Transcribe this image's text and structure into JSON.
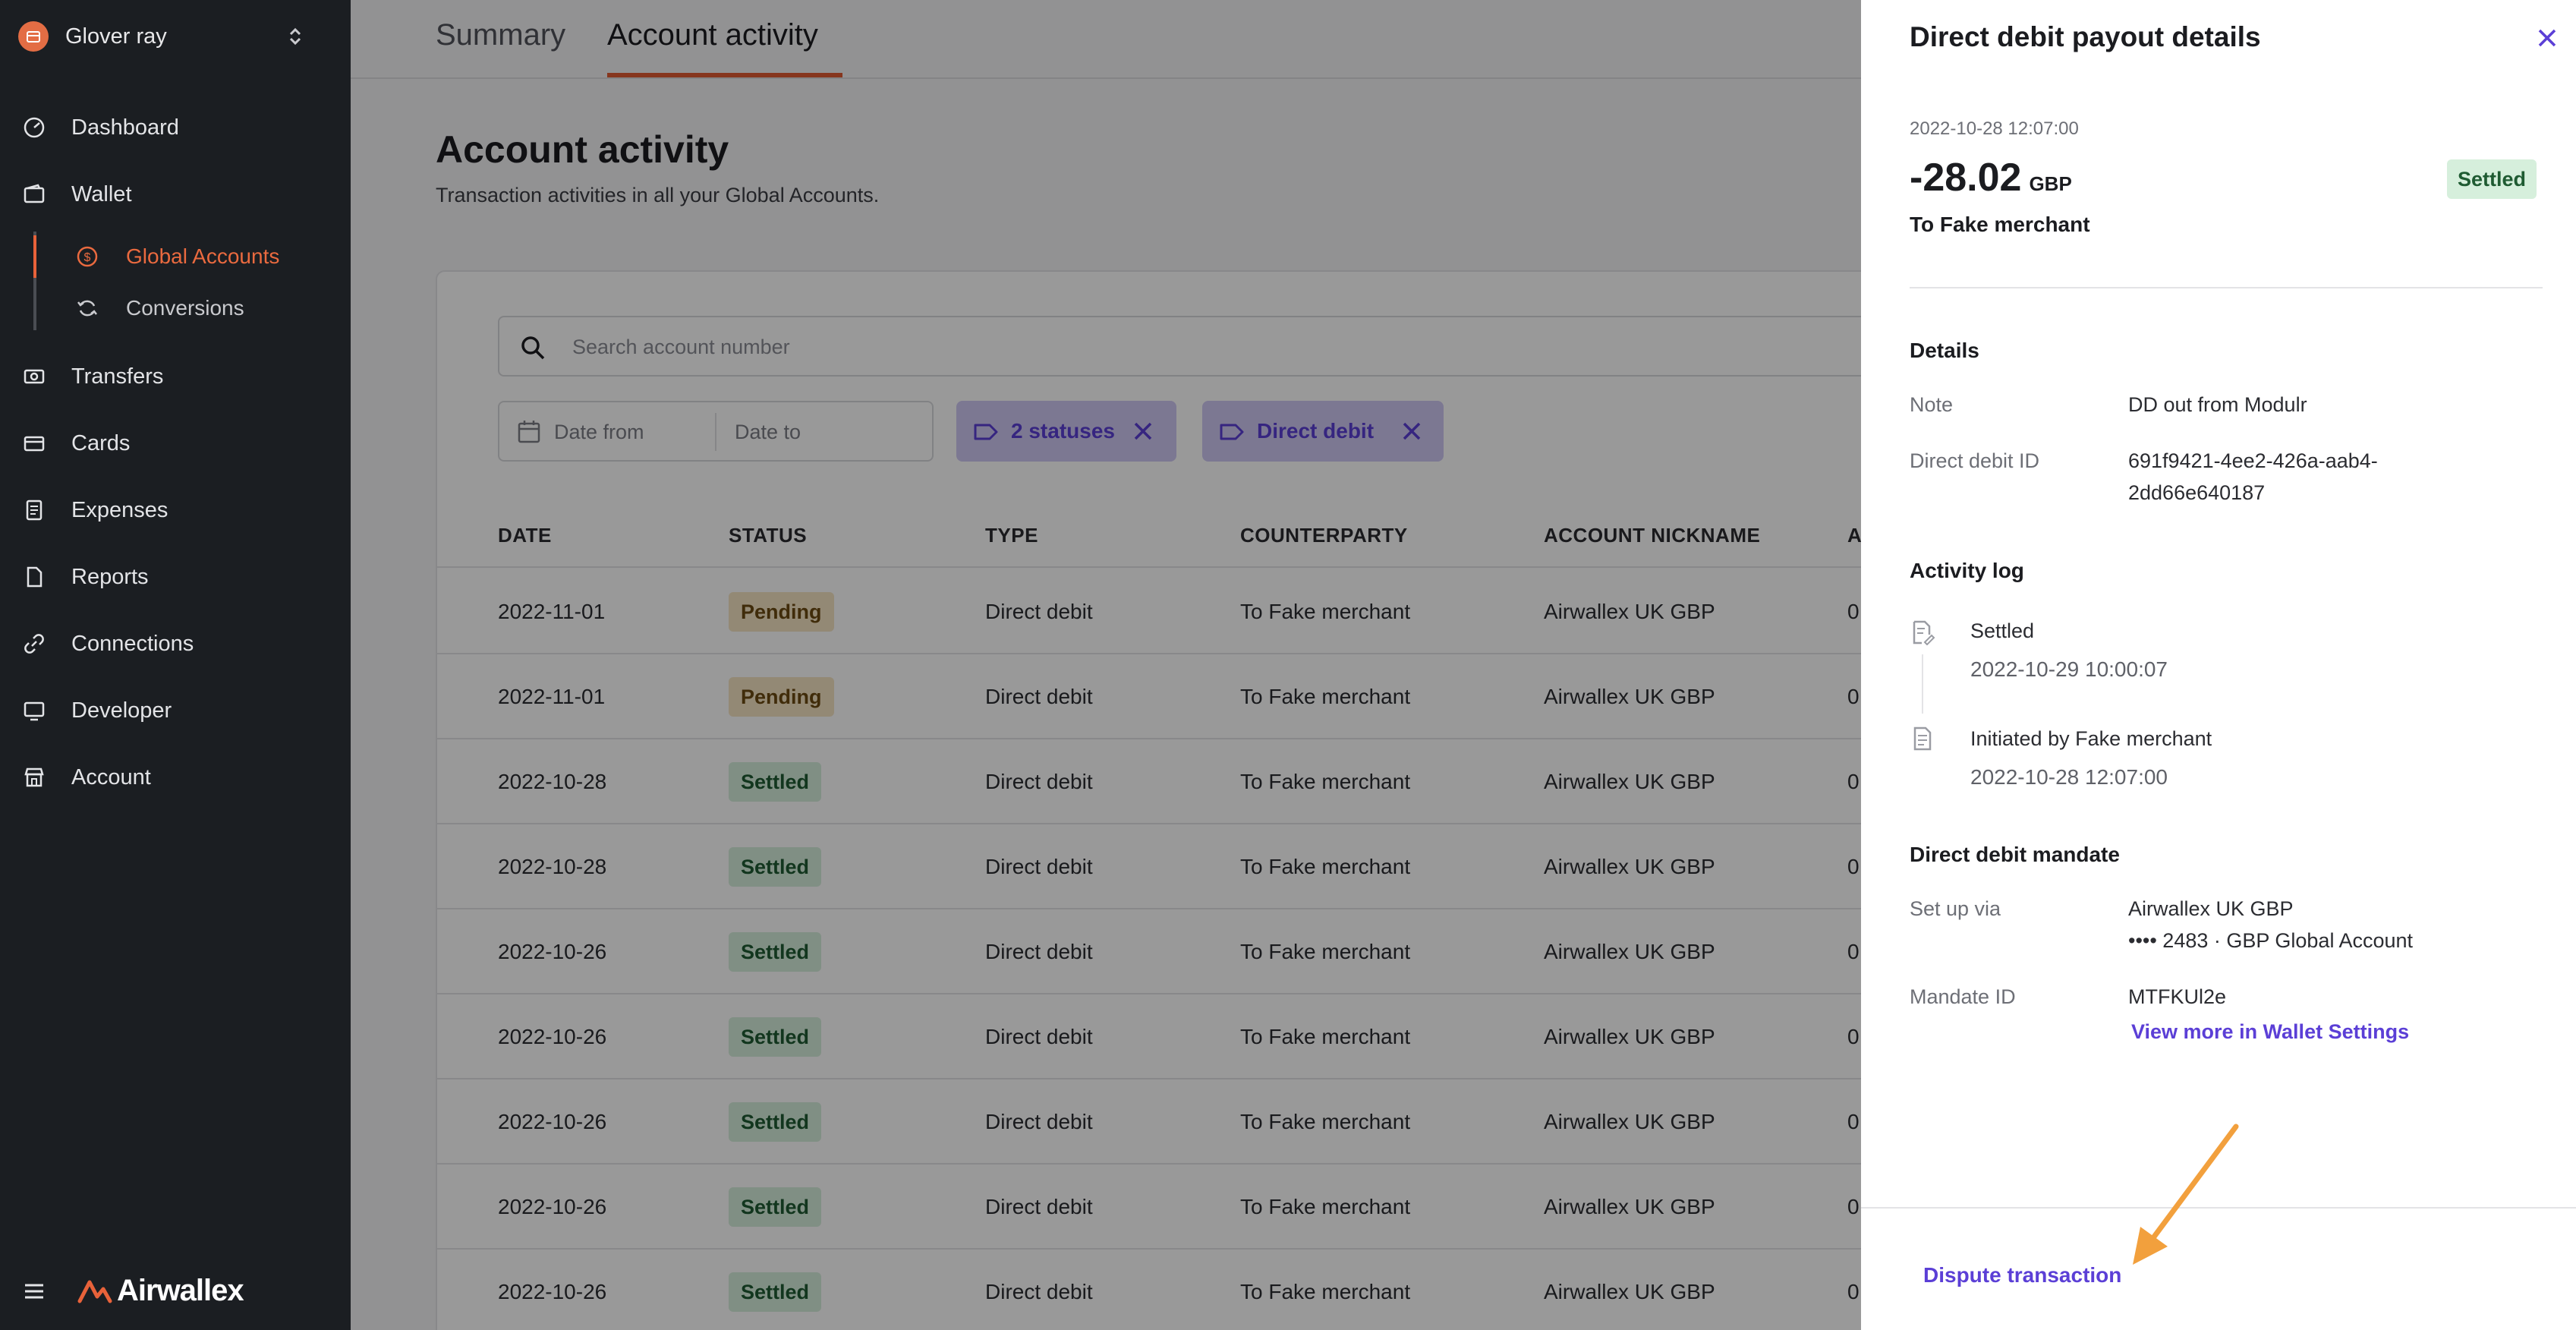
{
  "org": {
    "name": "Glover ray"
  },
  "sidebar": {
    "items": [
      {
        "label": "Dashboard",
        "icon": "dashboard-icon"
      },
      {
        "label": "Wallet",
        "icon": "wallet-icon"
      },
      {
        "label": "Transfers",
        "icon": "transfers-icon"
      },
      {
        "label": "Cards",
        "icon": "card-icon"
      },
      {
        "label": "Expenses",
        "icon": "expenses-icon"
      },
      {
        "label": "Reports",
        "icon": "reports-icon"
      },
      {
        "label": "Connections",
        "icon": "link-icon"
      },
      {
        "label": "Developer",
        "icon": "monitor-icon"
      },
      {
        "label": "Account",
        "icon": "store-icon"
      }
    ],
    "wallet_sub": [
      {
        "label": "Global Accounts",
        "icon": "currency-icon",
        "active": true
      },
      {
        "label": "Conversions",
        "icon": "refresh-icon",
        "active": false
      }
    ],
    "brand": "Airwallex"
  },
  "tabs": [
    {
      "label": "Summary",
      "active": false
    },
    {
      "label": "Account activity",
      "active": true
    }
  ],
  "page": {
    "title": "Account activity",
    "subtitle": "Transaction activities in all your Global Accounts."
  },
  "filters": {
    "search_placeholder": "Search account number",
    "date_from": "Date from",
    "date_to": "Date to",
    "chips": [
      {
        "label": "2 statuses"
      },
      {
        "label": "Direct debit"
      }
    ]
  },
  "table": {
    "columns": [
      "DATE",
      "STATUS",
      "TYPE",
      "COUNTERPARTY",
      "ACCOUNT NICKNAME",
      "A"
    ],
    "rows": [
      {
        "date": "2022-11-01",
        "status": "Pending",
        "type": "Direct debit",
        "counterparty": "To Fake merchant",
        "account": "Airwallex UK GBP",
        "extra": "0"
      },
      {
        "date": "2022-11-01",
        "status": "Pending",
        "type": "Direct debit",
        "counterparty": "To Fake merchant",
        "account": "Airwallex UK GBP",
        "extra": "0"
      },
      {
        "date": "2022-10-28",
        "status": "Settled",
        "type": "Direct debit",
        "counterparty": "To Fake merchant",
        "account": "Airwallex UK GBP",
        "extra": "0"
      },
      {
        "date": "2022-10-28",
        "status": "Settled",
        "type": "Direct debit",
        "counterparty": "To Fake merchant",
        "account": "Airwallex UK GBP",
        "extra": "0"
      },
      {
        "date": "2022-10-26",
        "status": "Settled",
        "type": "Direct debit",
        "counterparty": "To Fake merchant",
        "account": "Airwallex UK GBP",
        "extra": "0"
      },
      {
        "date": "2022-10-26",
        "status": "Settled",
        "type": "Direct debit",
        "counterparty": "To Fake merchant",
        "account": "Airwallex UK GBP",
        "extra": "0"
      },
      {
        "date": "2022-10-26",
        "status": "Settled",
        "type": "Direct debit",
        "counterparty": "To Fake merchant",
        "account": "Airwallex UK GBP",
        "extra": "0"
      },
      {
        "date": "2022-10-26",
        "status": "Settled",
        "type": "Direct debit",
        "counterparty": "To Fake merchant",
        "account": "Airwallex UK GBP",
        "extra": "0"
      },
      {
        "date": "2022-10-26",
        "status": "Settled",
        "type": "Direct debit",
        "counterparty": "To Fake merchant",
        "account": "Airwallex UK GBP",
        "extra": "0"
      }
    ]
  },
  "drawer": {
    "title": "Direct debit payout details",
    "datetime": "2022-10-28 12:07:00",
    "amount": "-28.02",
    "currency": "GBP",
    "status": "Settled",
    "to": "To Fake merchant",
    "details_title": "Details",
    "note_label": "Note",
    "note_value": "DD out from Modulr",
    "ddid_label": "Direct debit ID",
    "ddid_value_1": "691f9421-4ee2-426a-aab4-",
    "ddid_value_2": "2dd66e640187",
    "log_title": "Activity log",
    "log": [
      {
        "title": "Settled",
        "time": "2022-10-29 10:00:07"
      },
      {
        "title": "Initiated by Fake merchant",
        "time": "2022-10-28 12:07:00"
      }
    ],
    "mandate_title": "Direct debit mandate",
    "setup_label": "Set up via",
    "setup_value_1": "Airwallex UK GBP",
    "setup_value_2": "•••• 2483 · GBP Global Account",
    "mandate_id_label": "Mandate ID",
    "mandate_id_value": "MTFKUl2e",
    "wallet_link": "View more in Wallet Settings",
    "dispute": "Dispute transaction"
  },
  "colors": {
    "accent": "#e8623a",
    "link": "#5b3fd6",
    "sidebar_bg": "#1b1e22",
    "annotation_arrow": "#f2a03d"
  }
}
